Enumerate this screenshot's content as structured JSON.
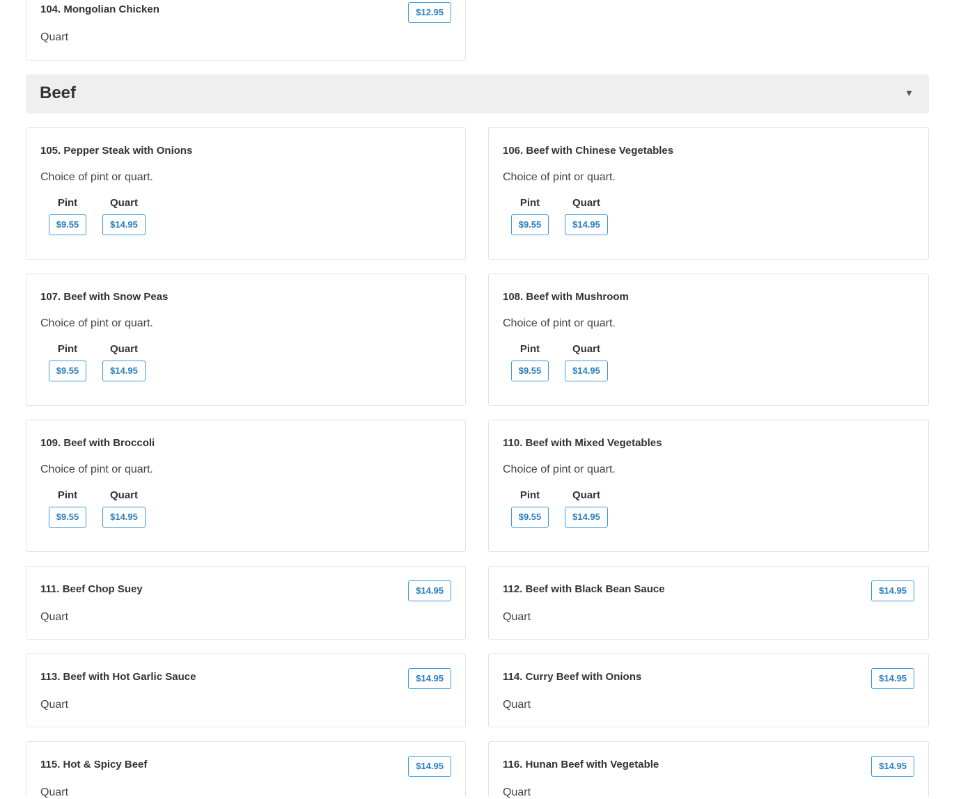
{
  "top_item": {
    "title": "104. Mongolian Chicken",
    "desc": "Quart",
    "price": "$12.95"
  },
  "section": {
    "title": "Beef",
    "caret": "▼"
  },
  "multi_items": [
    {
      "title": "105. Pepper Steak with Onions",
      "desc": "Choice of pint or quart.",
      "sizes": [
        {
          "label": "Pint",
          "price": "$9.55"
        },
        {
          "label": "Quart",
          "price": "$14.95"
        }
      ]
    },
    {
      "title": "106. Beef with Chinese Vegetables",
      "desc": "Choice of pint or quart.",
      "sizes": [
        {
          "label": "Pint",
          "price": "$9.55"
        },
        {
          "label": "Quart",
          "price": "$14.95"
        }
      ]
    },
    {
      "title": "107. Beef with Snow Peas",
      "desc": "Choice of pint or quart.",
      "sizes": [
        {
          "label": "Pint",
          "price": "$9.55"
        },
        {
          "label": "Quart",
          "price": "$14.95"
        }
      ]
    },
    {
      "title": "108. Beef with Mushroom",
      "desc": "Choice of pint or quart.",
      "sizes": [
        {
          "label": "Pint",
          "price": "$9.55"
        },
        {
          "label": "Quart",
          "price": "$14.95"
        }
      ]
    },
    {
      "title": "109. Beef with Broccoli",
      "desc": "Choice of pint or quart.",
      "sizes": [
        {
          "label": "Pint",
          "price": "$9.55"
        },
        {
          "label": "Quart",
          "price": "$14.95"
        }
      ]
    },
    {
      "title": "110. Beef with Mixed Vegetables",
      "desc": "Choice of pint or quart.",
      "sizes": [
        {
          "label": "Pint",
          "price": "$9.55"
        },
        {
          "label": "Quart",
          "price": "$14.95"
        }
      ]
    }
  ],
  "single_items": [
    {
      "title": "111. Beef Chop Suey",
      "desc": "Quart",
      "price": "$14.95"
    },
    {
      "title": "112. Beef with Black Bean Sauce",
      "desc": "Quart",
      "price": "$14.95"
    },
    {
      "title": "113. Beef with Hot Garlic Sauce",
      "desc": "Quart",
      "price": "$14.95"
    },
    {
      "title": "114. Curry Beef with Onions",
      "desc": "Quart",
      "price": "$14.95"
    },
    {
      "title": "115. Hot & Spicy Beef",
      "desc": "Quart",
      "price": "$14.95"
    },
    {
      "title": "116. Hunan Beef with Vegetable",
      "desc": "Quart",
      "price": "$14.95"
    }
  ],
  "colors": {
    "accent": "#2a7fc1",
    "header_bg": "#efefef"
  }
}
